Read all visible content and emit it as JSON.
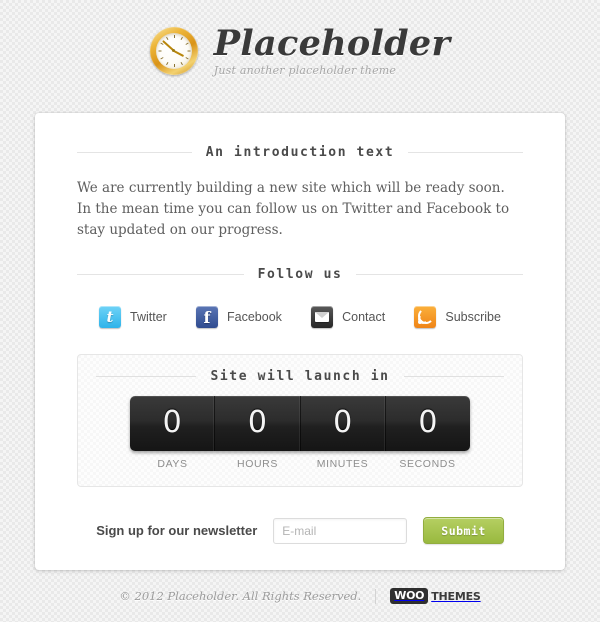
{
  "header": {
    "logo_icon": "clock-icon",
    "title": "Placeholder",
    "tagline": "Just another placeholder theme"
  },
  "intro": {
    "heading": "An introduction text",
    "body": "We are currently building a new site which will be ready soon. In the mean time you can follow us on Twitter and Facebook to stay updated on our progress."
  },
  "follow": {
    "heading": "Follow us",
    "items": [
      {
        "label": "Twitter",
        "icon": "twitter-icon",
        "color": "#3eb8e8"
      },
      {
        "label": "Facebook",
        "icon": "facebook-icon",
        "color": "#3b5998"
      },
      {
        "label": "Contact",
        "icon": "envelope-icon",
        "color": "#333333"
      },
      {
        "label": "Subscribe",
        "icon": "rss-icon",
        "color": "#f08a1c"
      }
    ]
  },
  "countdown": {
    "heading": "Site will launch in",
    "units": [
      {
        "value": "0",
        "label": "DAYS"
      },
      {
        "value": "0",
        "label": "HOURS"
      },
      {
        "value": "0",
        "label": "MINUTES"
      },
      {
        "value": "0",
        "label": "SECONDS"
      }
    ]
  },
  "newsletter": {
    "label": "Sign up for our newsletter",
    "input_value": "",
    "input_placeholder": "E-mail",
    "submit_label": "Submit",
    "button_color": "#a3c14a"
  },
  "footer": {
    "copyright": "© 2012 Placeholder. All Rights Reserved.",
    "woo_badge": "WOO",
    "woo_text": "THEMES"
  }
}
